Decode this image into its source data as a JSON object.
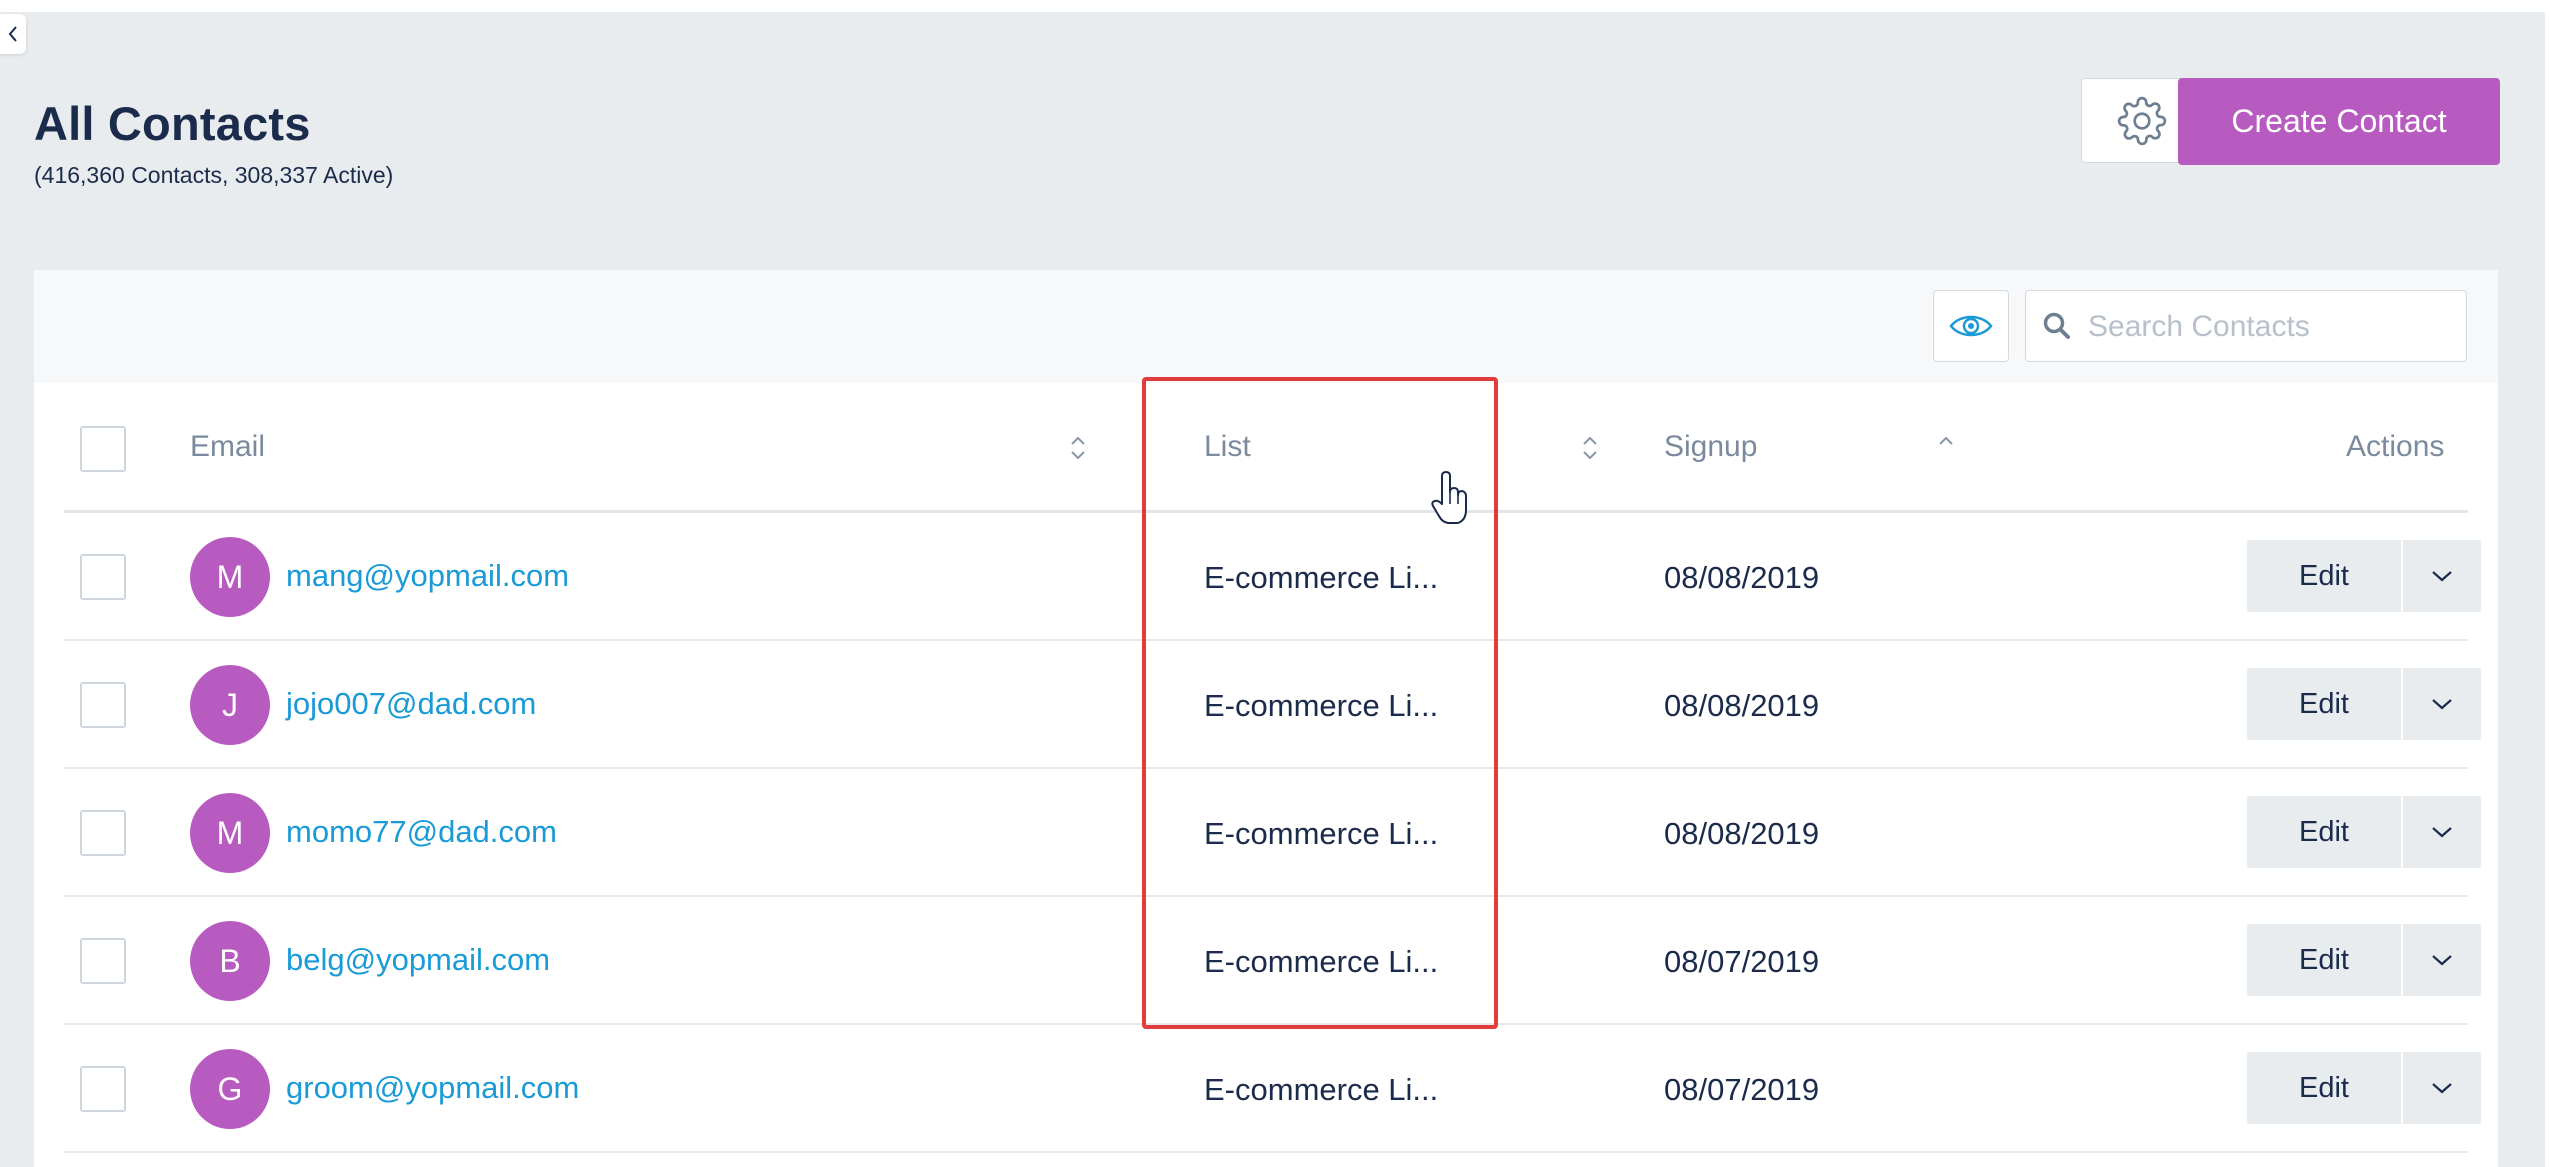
{
  "header": {
    "title": "All Contacts",
    "subtitle": "(416,360 Contacts, 308,337 Active)",
    "create_label": "Create Contact"
  },
  "search": {
    "placeholder": "Search Contacts"
  },
  "columns": {
    "email": "Email",
    "list": "List",
    "signup": "Signup",
    "actions": "Actions"
  },
  "rows": [
    {
      "initial": "M",
      "email": "mang@yopmail.com",
      "list": "E-commerce Li...",
      "signup": "08/08/2019",
      "edit": "Edit"
    },
    {
      "initial": "J",
      "email": "jojo007@dad.com",
      "list": "E-commerce Li...",
      "signup": "08/08/2019",
      "edit": "Edit"
    },
    {
      "initial": "M",
      "email": "momo77@dad.com",
      "list": "E-commerce Li...",
      "signup": "08/08/2019",
      "edit": "Edit"
    },
    {
      "initial": "B",
      "email": "belg@yopmail.com",
      "list": "E-commerce Li...",
      "signup": "08/07/2019",
      "edit": "Edit"
    },
    {
      "initial": "G",
      "email": "groom@yopmail.com",
      "list": "E-commerce Li...",
      "signup": "08/07/2019",
      "edit": "Edit"
    }
  ],
  "colors": {
    "accent": "#b85bc1",
    "link": "#1a9ad6",
    "highlight": "#e23b3b",
    "text": "#1b2b4b"
  },
  "icons": [
    "chevron-left-icon",
    "gear-icon",
    "eye-icon",
    "search-icon",
    "sort-icon",
    "chevron-down-icon",
    "hand-cursor-icon"
  ]
}
